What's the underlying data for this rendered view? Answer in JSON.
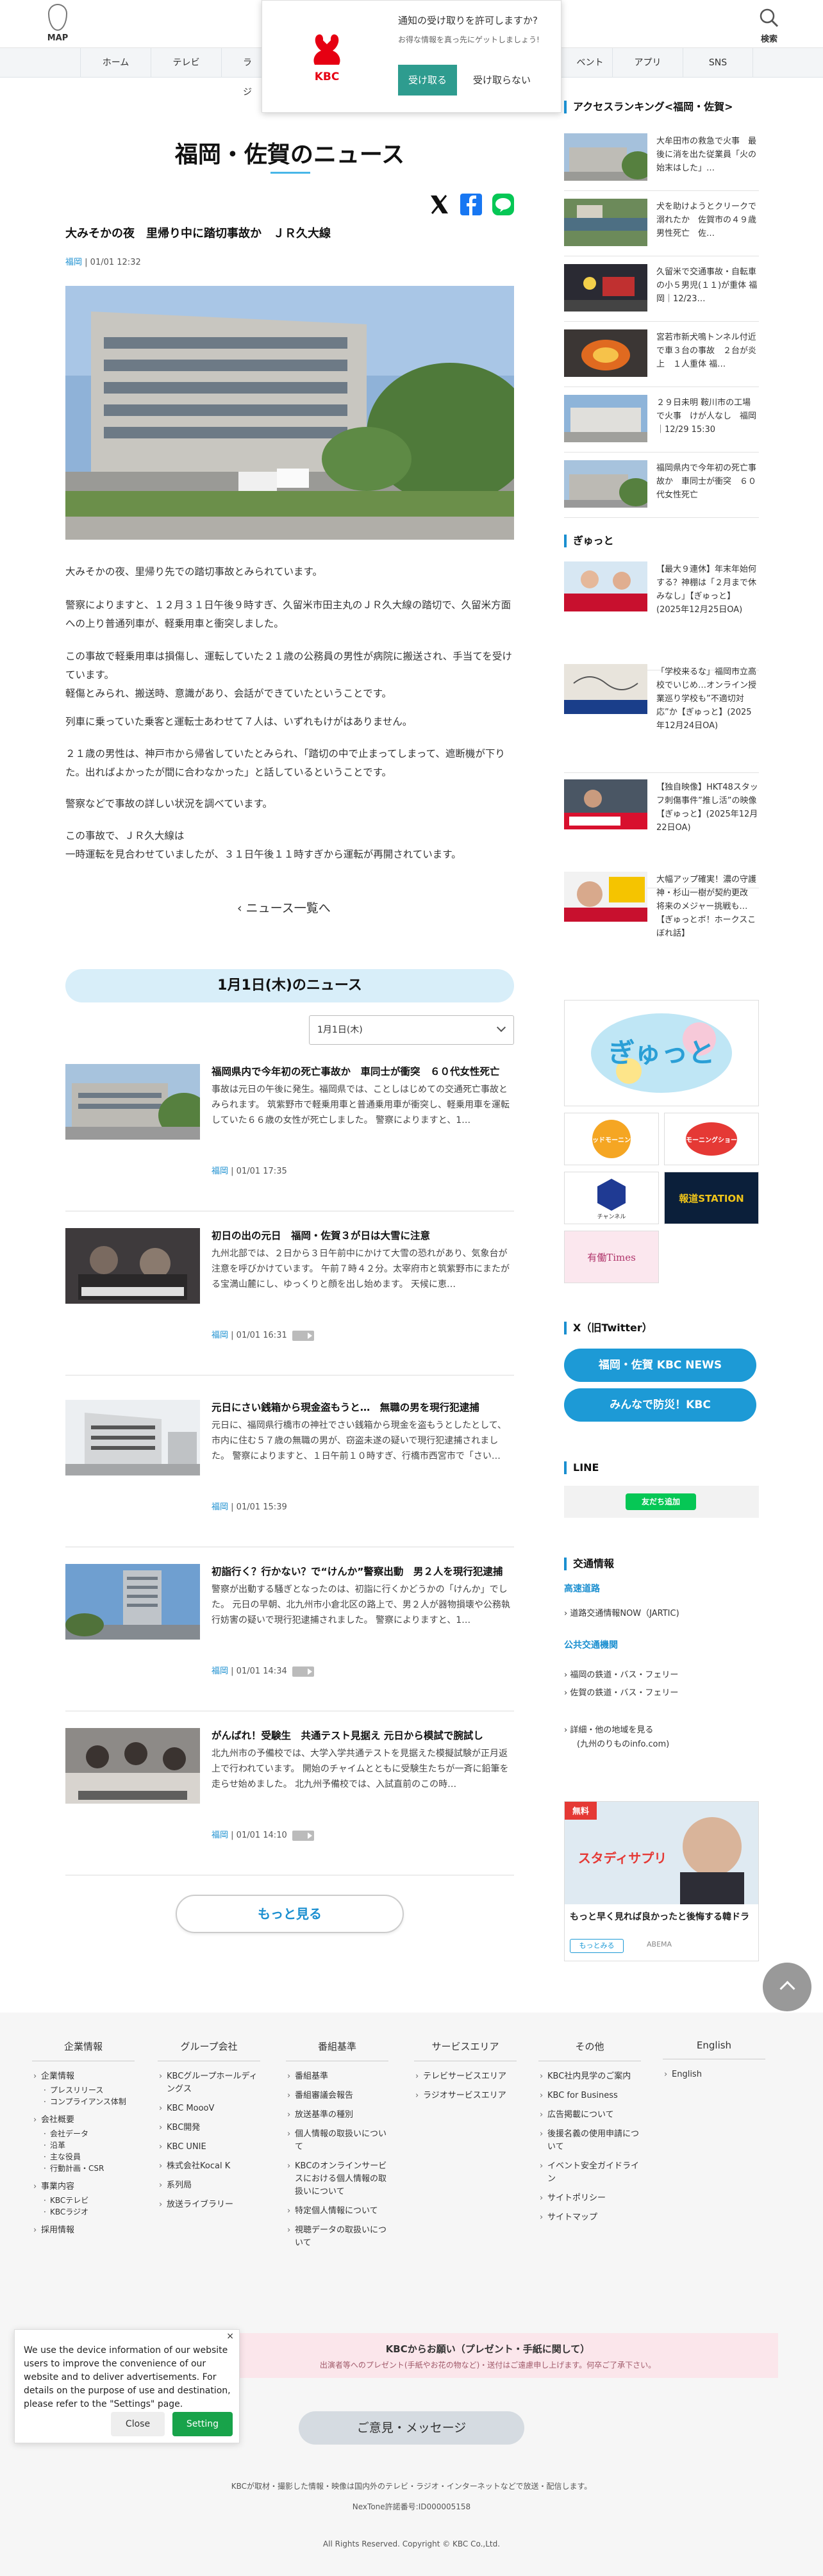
{
  "header": {
    "map_label": "MAP",
    "search_label": "検索",
    "nav": [
      "ホーム",
      "テレビ",
      "ラジ",
      "ベント",
      "アプリ",
      "SNS"
    ]
  },
  "notify": {
    "question": "通知の受け取りを許可しますか?",
    "sub": "お得な情報を真っ先にゲットしましょう!",
    "accept": "受け取る",
    "decline": "受け取らない",
    "logo_text": "KBC"
  },
  "main": {
    "page_title": "福岡・佐賀のニュース",
    "article": {
      "title": "大みそかの夜　里帰り中に踏切事故か　ＪＲ久大線",
      "pref": "福岡",
      "date": "01/01 12:32",
      "paragraphs": [
        "大みそかの夜、里帰り先での踏切事故とみられています。",
        "警察によりますと、１２月３１日午後９時すぎ、久留米市田主丸のＪＲ久大線の踏切で、久留米方面への上り普通列車が、軽乗用車と衝突しました。",
        "この事故で軽乗用車は損傷し、運転していた２１歳の公務員の男性が病院に搬送され、手当てを受けています。\n軽傷とみられ、搬送時、意識があり、会話ができていたということです。",
        "列車に乗っていた乗客と運転士あわせて７人は、いずれもけがはありません。",
        "２１歳の男性は、神戸市から帰省していたとみられ、「踏切の中で止まってしまって、遮断機が下りた。出ればよかったが間に合わなかった」と話しているということです。",
        "警察などで事故の詳しい状況を調べています。",
        "この事故で、ＪＲ久大線は\n一時運転を見合わせていましたが、３１日午後１１時すぎから運転が再開されています。"
      ]
    },
    "back_label": "ニュース一覧へ",
    "day_banner": "1月1日(木)のニュース",
    "day_select": "1月1日(木)",
    "news": [
      {
        "title": "福岡県内で今年初の死亡事故か　車同士が衝突　６０代女性死亡",
        "excerpt": "事故は元日の午後に発生。福岡県では、ことしはじめての交通死亡事故とみられます。 筑紫野市で軽乗用車と普通乗用車が衝突し、軽乗用車を運転していた６６歳の女性が死亡しました。 警察によりますと、1…",
        "pref": "福岡",
        "date": "01/01 17:35",
        "video": false
      },
      {
        "title": "初日の出の元日　福岡・佐賀３が日は大雪に注意",
        "excerpt": "九州北部では、２日から３日午前中にかけて大雪の恐れがあり、気象台が注意を呼びかけています。 午前７時４２分。太宰府市と筑紫野市にまたがる宝満山麓にし、ゆっくりと顔を出し始めます。 天候に恵…",
        "pref": "福岡",
        "date": "01/01 16:31",
        "video": true
      },
      {
        "title": "元日にさい銭箱から現金盗もうと…　無職の男を現行犯逮捕",
        "excerpt": "元日に、福岡県行橋市の神社でさい銭箱から現金を盗もうとしたとして、市内に住む５７歳の無職の男が、窃盗未遂の疑いで現行犯逮捕されました。 警察によりますと、１日午前１０時すぎ、行橋市西宮市で「さい…",
        "pref": "福岡",
        "date": "01/01 15:39",
        "video": false
      },
      {
        "title": "初詣行く？行かない？で“けんか”警察出動　男２人を現行犯逮捕",
        "excerpt": "警察が出動する騒ぎとなったのは、初詣に行くかどうかの「けんか」でした。 元日の早朝、北九州市小倉北区の路上で、男２人が器物損壊や公務執行妨害の疑いで現行犯逮捕されました。 警察によりますと、1…",
        "pref": "福岡",
        "date": "01/01 14:34",
        "video": true
      },
      {
        "title": "がんばれ！受験生　共通テスト見据え 元日から模試で腕試し",
        "excerpt": "北九州市の予備校では、大学入学共通テストを見据えた模擬試験が正月返上で行われています。 開始のチャイムとともに受験生たちが一斉に鉛筆を走らせ始めました。 北九州予備校では、入試直前のこの時…",
        "pref": "福岡",
        "date": "01/01 14:10",
        "video": true
      }
    ],
    "more_label": "もっと見る"
  },
  "sidebar": {
    "ranking_title": "アクセスランキング<福岡・佐賀>",
    "ranking": [
      "大牟田市の救急で火事　最後に消を出た従業員「火の始末はした」…",
      "犬を助けようとクリークで溺れたか　佐賀市の４９歳男性死亡　佐…",
      "久留米で交通事故・自転車の小５男児(１１)が重体 福岡｜12/23…",
      "宮若市新犬鳴トンネル付近で車３台の事故　２台が炎上　１人重体 福…",
      "２９日未明 鞍川市の工場で火事　けが人なし　福岡｜12/29 15:30",
      "福岡県内で今年初の死亡事故か　車同士が衝突　６０代女性死亡"
    ],
    "gyutto_title": "ぎゅっと",
    "gyutto": [
      "【最大９連休】年末年始何する？神棚は「２月まで休みなし」【ぎゅっと】(2025年12月25日OA)",
      "「学校来るな」福岡市立高校でいじめ…オンライン授業巡り学校も”不適切対応”か【ぎゅっと】(2025年12月24日OA)",
      "【独自映像】HKT48スタッフ刺傷事件”推し活”の映像【ぎゅっと】(2025年12月22日OA)",
      "大幅アップ確実！濃の守護神・杉山一樹が契約更改　将来のメジャー挑戦も…【ぎゅっとボ！ホークスこぼれ話】"
    ],
    "banners": {
      "gyutto_logo": "ぎゅっと",
      "dodo": "ウッドモーニング",
      "morning": "モーニングショー",
      "channel": "チャンネル",
      "station": "報道STATION",
      "times": "有働Times"
    },
    "x_title": "X（旧Twitter）",
    "x_buttons": [
      "福岡・佐賀 KBC NEWS",
      "みんなで防災！KBC"
    ],
    "line_title": "LINE",
    "line_button": "友だち追加",
    "traffic_title": "交通情報",
    "traffic_sub1": "高速道路",
    "traffic_link1": "道路交通情報NOW（JARTIC)",
    "traffic_sub2": "公共交通機関",
    "traffic_link2": "福岡の鉄道・バス・フェリー",
    "traffic_link3": "佐賀の鉄道・バス・フェリー",
    "traffic_link4": "詳細・他の地域を見る",
    "traffic_link4b": "(九州のりものinfo.com)",
    "ad_badge": "無料",
    "ad_banner_text": "スタディサプリ",
    "ad_text": "もっと早く見れば良かったと後悔する韓ドラ",
    "ad_btn": "もっとみる",
    "ad_brand": "ABEMA"
  },
  "footer": {
    "cols": [
      {
        "head": "企業情報",
        "items": [
          "企業情報",
          "会社概要",
          "事業内容",
          "採用情報"
        ]
      },
      {
        "head": "グループ会社",
        "items": [
          "KBCグループホールディングス",
          "KBC MoooV",
          "KBC開発",
          "KBC UNIE",
          "株式会社Kocal K",
          "系列局",
          "放送ライブラリー"
        ]
      },
      {
        "head": "番組基準",
        "items": [
          "番組基準",
          "番組審議会報告",
          "放送基準の種別",
          "個人情報の取扱いについて",
          "KBCのオンラインサービスにおける個人情報の取扱いについて",
          "特定個人情報について",
          "視聴データの取扱いについて"
        ]
      },
      {
        "head": "サービスエリア",
        "items": [
          "テレビサービスエリア",
          "ラジオサービスエリア"
        ]
      },
      {
        "head": "その他",
        "items": [
          "KBC社内見学のご案内",
          "KBC for Business",
          "広告掲載について",
          "後援名義の使用申請について",
          "イベント安全ガイドライン",
          "サイトポリシー",
          "サイトマップ"
        ]
      },
      {
        "head": "English",
        "items": [
          "English"
        ]
      }
    ],
    "sub_company": [
      "プレスリリース",
      "コンプライアンス体制"
    ],
    "sub_gaiyou": [
      "会社データ",
      "沿革",
      "主な役員",
      "行動計画・CSR"
    ],
    "sub_jigyou": [
      "KBCテレビ",
      "KBCラジオ"
    ],
    "request_title": "KBCからお願い（プレゼント・手紙に関して）",
    "request_sub": "出演者等へのプレゼント(手紙やお花の物など)・送付はご遠慮申し上げます。何卒ご了承下さい。",
    "opinion": "ご意見・メッセージ",
    "note1": "KBCが取材・撮影した情報・映像は国内外のテレビ・ラジオ・インターネットなどで放送・配信します。",
    "note2": "NexTone許諾番号:ID000005158",
    "copyright": "All Rights Reserved. Copyright © KBC Co.,Ltd."
  },
  "cookie": {
    "text": "We use the device information of our website users to improve the convenience of our website and to deliver advertisements. For details on the purpose of use and destination, please refer to the \"Settings\" page.",
    "close": "Close",
    "setting": "Setting"
  }
}
